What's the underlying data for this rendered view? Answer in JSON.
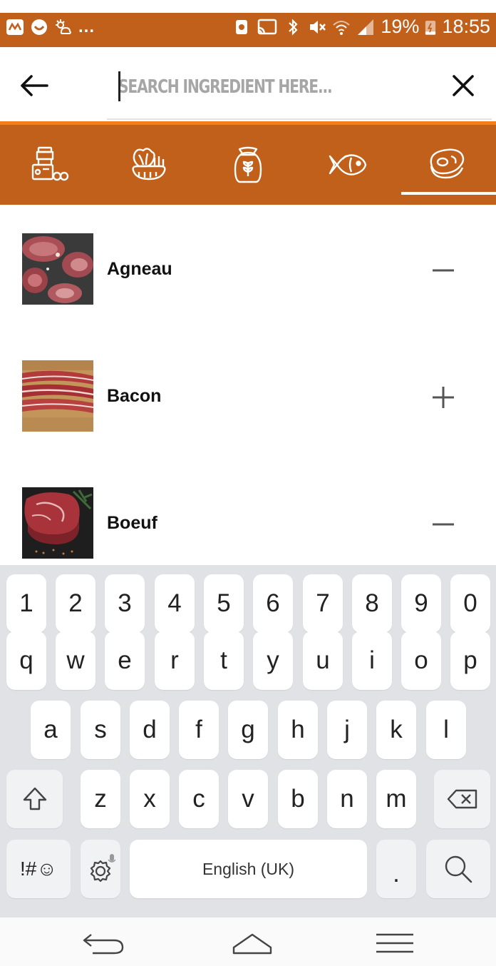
{
  "status_bar": {
    "left_icons": [
      "app-icon",
      "chat-icon",
      "weather-icon"
    ],
    "overflow": "...",
    "battery_percent": "19%",
    "time": "18:55"
  },
  "search": {
    "placeholder": "SEARCH INGREDIENT HERE...",
    "value": ""
  },
  "categories": [
    {
      "icon": "pantry-icon"
    },
    {
      "icon": "vegetables-icon"
    },
    {
      "icon": "flour-sack-icon"
    },
    {
      "icon": "fish-icon"
    },
    {
      "icon": "meat-icon",
      "selected": true
    }
  ],
  "ingredients": [
    {
      "name": "Agneau",
      "action": "remove"
    },
    {
      "name": "Bacon",
      "action": "add"
    },
    {
      "name": "Boeuf",
      "action": "remove"
    }
  ],
  "keyboard": {
    "row_numbers": [
      "1",
      "2",
      "3",
      "4",
      "5",
      "6",
      "7",
      "8",
      "9",
      "0"
    ],
    "row_1": [
      "q",
      "w",
      "e",
      "r",
      "t",
      "y",
      "u",
      "i",
      "o",
      "p"
    ],
    "row_2": [
      "a",
      "s",
      "d",
      "f",
      "g",
      "h",
      "j",
      "k",
      "l"
    ],
    "row_3": [
      "z",
      "x",
      "c",
      "v",
      "b",
      "n",
      "m"
    ],
    "symbols_key": "!#☺",
    "space_label": "English (UK)",
    "period_key": "."
  },
  "colors": {
    "brand": "#c0601b",
    "accent": "#ef7f1e"
  }
}
